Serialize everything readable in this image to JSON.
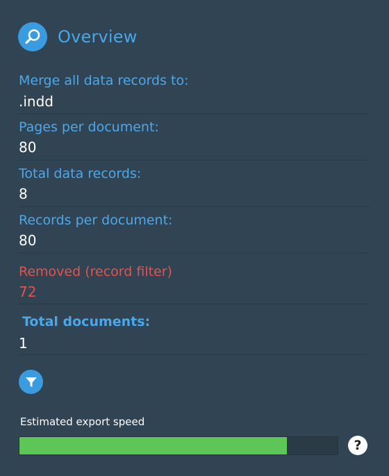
{
  "header": {
    "title": "Overview",
    "icon": "search-icon"
  },
  "overview": {
    "merge_label": "Merge all data records to:",
    "merge_value": ".indd",
    "pages_label": "Pages per document:",
    "pages_value": "80",
    "total_records_label": "Total data records:",
    "total_records_value": "8",
    "records_per_doc_label": "Records per document:",
    "records_per_doc_value": "80",
    "removed_label": "Removed (record filter)",
    "removed_value": "72",
    "total_docs_label": "Total documents:",
    "total_docs_value": "1"
  },
  "filter": {
    "icon": "filter-icon"
  },
  "export_speed": {
    "label": "Estimated export speed",
    "level": 0.84,
    "help_glyph": "?"
  },
  "colors": {
    "background": "#314453",
    "accent": "#49a6e8",
    "removed": "#e9514d",
    "speed_fill": "#5ec657"
  }
}
